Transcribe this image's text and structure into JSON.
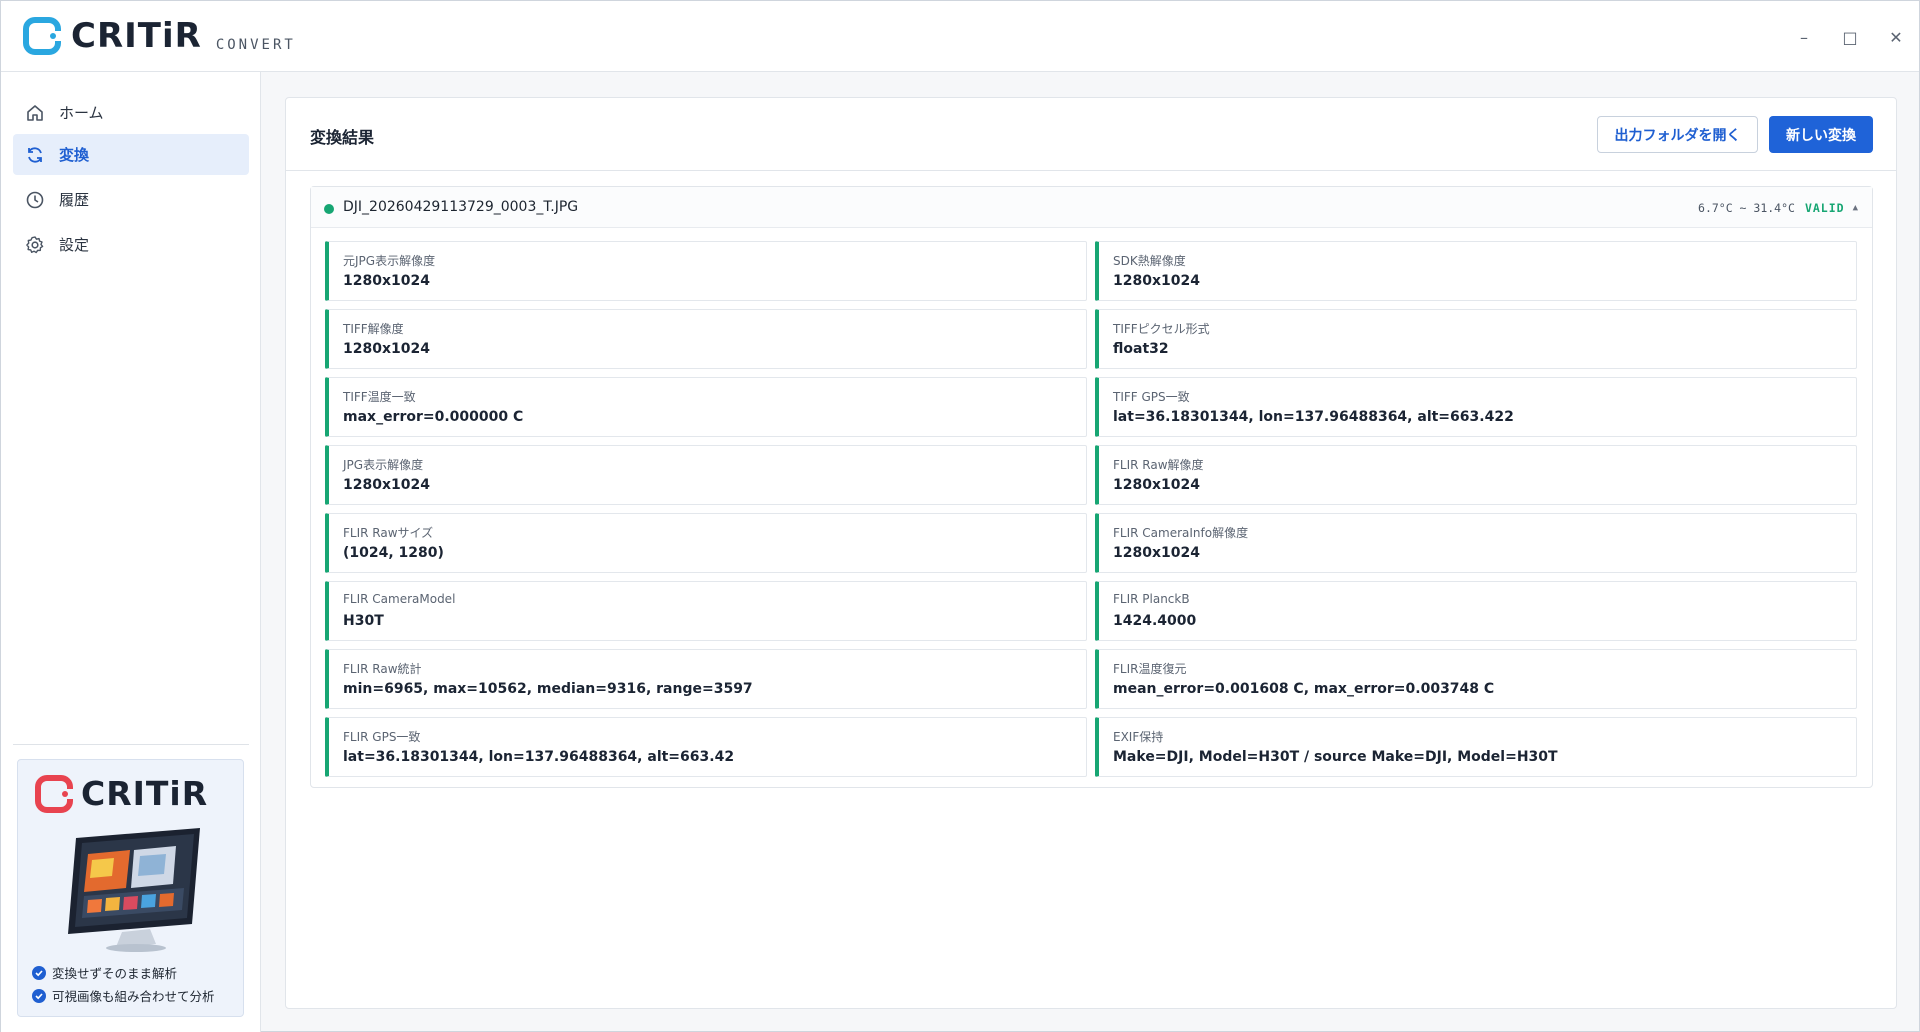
{
  "app": {
    "name": "CRITiR",
    "subtitle": "CONVERT",
    "window_controls": {
      "minimize": "–",
      "maximize": "□",
      "close": "✕"
    }
  },
  "sidebar": {
    "items": [
      {
        "label": "ホーム",
        "icon": "home-icon"
      },
      {
        "label": "変換",
        "icon": "refresh-icon",
        "active": true
      },
      {
        "label": "履歴",
        "icon": "clock-icon"
      },
      {
        "label": "設定",
        "icon": "gear-icon"
      }
    ],
    "promo": {
      "brand": "CRITiR",
      "features": [
        "変換せずそのまま解析",
        "可視画像も組み合わせて分析"
      ]
    }
  },
  "main": {
    "title": "変換結果",
    "open_folder_button": "出力フォルダを開く",
    "new_convert_button": "新しい変換",
    "file": {
      "name": "DJI_20260429113729_0003_T.JPG",
      "temp_range": "6.7°C ~ 31.4°C",
      "status": "VALID",
      "status_color": "#17a673",
      "caret": "▲"
    },
    "results": [
      {
        "label": "元JPG表示解像度",
        "value": "1280x1024"
      },
      {
        "label": "SDK熱解像度",
        "value": "1280x1024"
      },
      {
        "label": "TIFF解像度",
        "value": "1280x1024"
      },
      {
        "label": "TIFFピクセル形式",
        "value": "float32"
      },
      {
        "label": "TIFF温度一致",
        "value": "max_error=0.000000 C"
      },
      {
        "label": "TIFF GPS一致",
        "value": "lat=36.18301344, lon=137.96488364, alt=663.422"
      },
      {
        "label": "JPG表示解像度",
        "value": "1280x1024"
      },
      {
        "label": "FLIR Raw解像度",
        "value": "1280x1024"
      },
      {
        "label": "FLIR Rawサイズ",
        "value": "(1024, 1280)"
      },
      {
        "label": "FLIR CameraInfo解像度",
        "value": "1280x1024"
      },
      {
        "label": "FLIR CameraModel",
        "value": "H30T"
      },
      {
        "label": "FLIR PlanckB",
        "value": "1424.4000"
      },
      {
        "label": "FLIR Raw統計",
        "value": "min=6965, max=10562, median=9316, range=3597"
      },
      {
        "label": "FLIR温度復元",
        "value": "mean_error=0.001608 C, max_error=0.003748 C"
      },
      {
        "label": "FLIR GPS一致",
        "value": "lat=36.18301344, lon=137.96488364, alt=663.42"
      },
      {
        "label": "EXIF保持",
        "value": "Make=DJI, Model=H30T / source Make=DJI, Model=H30T"
      }
    ]
  },
  "colors": {
    "accent": "#1f63d8",
    "success": "#17a673",
    "logo_blue": "#2aa7e0",
    "logo_red": "#e8434f"
  }
}
